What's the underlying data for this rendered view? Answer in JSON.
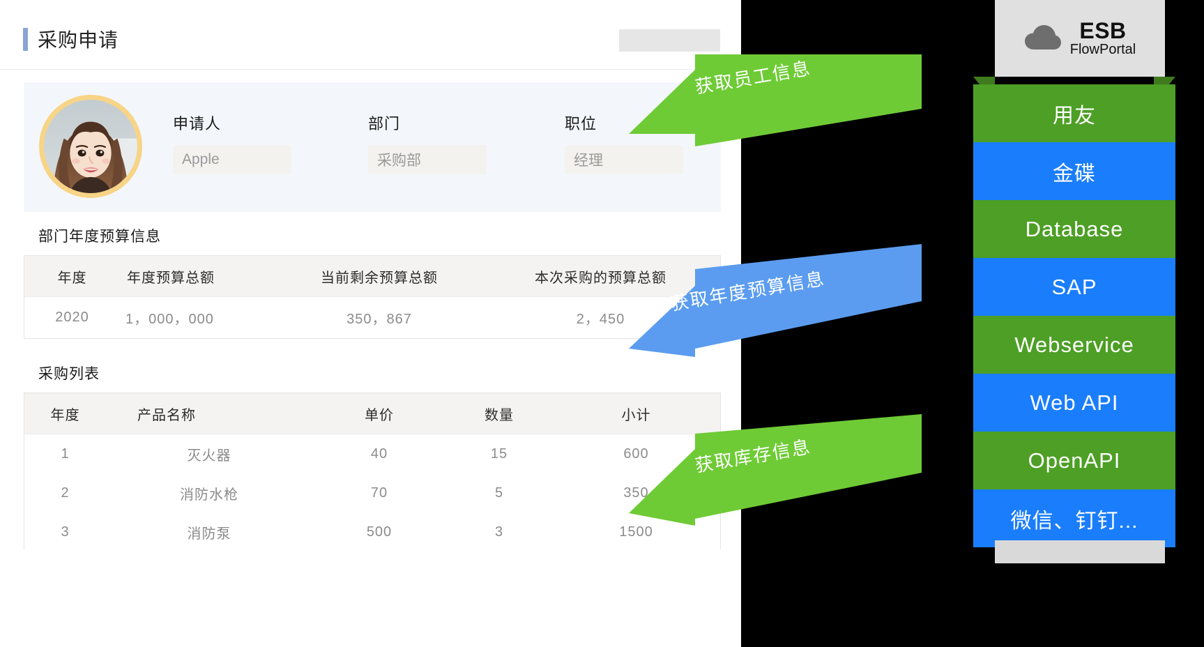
{
  "form": {
    "title": "采购申请",
    "applicant": {
      "fields": [
        {
          "label": "申请人",
          "value": "Apple",
          "name": "applicant"
        },
        {
          "label": "部门",
          "value": "采购部",
          "name": "department"
        },
        {
          "label": "职位",
          "value": "经理",
          "name": "position"
        }
      ]
    },
    "budget_section": {
      "title": "部门年度预算信息",
      "headers": [
        "年度",
        "年度预算总额",
        "当前剩余预算总额",
        "本次采购的预算总额"
      ],
      "rows": [
        [
          "2020",
          "1，000，000",
          "350，867",
          "2，450"
        ]
      ]
    },
    "list_section": {
      "title": "采购列表",
      "headers": [
        "年度",
        "产品名称",
        "单价",
        "数量",
        "小计"
      ],
      "rows": [
        [
          "1",
          "灭火器",
          "40",
          "15",
          "600"
        ],
        [
          "2",
          "消防水枪",
          "70",
          "5",
          "350"
        ],
        [
          "3",
          "消防泵",
          "500",
          "3",
          "1500"
        ]
      ]
    }
  },
  "esb": {
    "icon": "cloud-icon",
    "title": "ESB",
    "subtitle": "FlowPortal",
    "services": [
      {
        "label": "用友",
        "color": "#4d9f25",
        "cjk": true
      },
      {
        "label": "金碟",
        "color": "#1a7dfb",
        "cjk": true
      },
      {
        "label": "Database",
        "color": "#4d9f25",
        "cjk": false
      },
      {
        "label": "SAP",
        "color": "#1a7dfb",
        "cjk": false
      },
      {
        "label": "Webservice",
        "color": "#4d9f25",
        "cjk": false
      },
      {
        "label": "Web API",
        "color": "#1a7dfb",
        "cjk": false
      },
      {
        "label": "OpenAPI",
        "color": "#4d9f25",
        "cjk": false
      },
      {
        "label": "微信、钉钉...",
        "color": "#1a7dfb",
        "cjk": true
      }
    ]
  },
  "arrows": [
    {
      "label": "获取员工信息",
      "color": "#6ecb35"
    },
    {
      "label": "获取年度预算信息",
      "color": "#5b9cf0"
    },
    {
      "label": "获取库存信息",
      "color": "#6ecb35"
    }
  ],
  "colors": {
    "accent_title_bar": "#8aa4d6",
    "panel_bg": "#ffffff",
    "applicant_bg": "#f3f7fc",
    "table_header_bg": "#f4f3f1",
    "green": "#4d9f25",
    "blue": "#1a7dfb",
    "arrow_green": "#6ecb35",
    "arrow_blue": "#5b9cf0",
    "avatar_ring": "#f7d486"
  }
}
